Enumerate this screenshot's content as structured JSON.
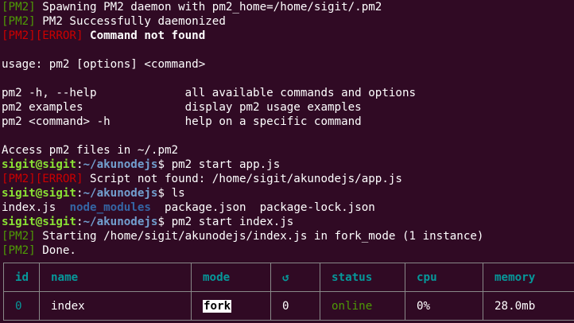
{
  "terminal": {
    "lines": [
      {
        "tag": "[PM2]",
        "text": " Spawning PM2 daemon with pm2_home=/home/sigit/.pm2"
      },
      {
        "tag": "[PM2]",
        "text": " PM2 Successfully daemonized"
      },
      {
        "tag": "[PM2][ERROR]",
        "bold_text": " Command not found"
      },
      {
        "text": ""
      },
      {
        "text": "usage: pm2 [options] <command>"
      },
      {
        "text": ""
      },
      {
        "text": "pm2 -h, --help             all available commands and options"
      },
      {
        "text": "pm2 examples               display pm2 usage examples"
      },
      {
        "text": "pm2 <command> -h           help on a specific command"
      },
      {
        "text": ""
      },
      {
        "text": "Access pm2 files in ~/.pm2"
      },
      {
        "prompt_user": "sigit@sigit",
        "prompt_path": "~/akunodejs",
        "command": " pm2 start app.js"
      },
      {
        "tag": "[PM2][ERROR]",
        "text": " Script not found: /home/sigit/akunodejs/app.js"
      },
      {
        "prompt_user": "sigit@sigit",
        "prompt_path": "~/akunodejs",
        "command": " ls"
      },
      {
        "ls": [
          "index.js",
          "node_modules",
          "package.json",
          "package-lock.json"
        ]
      },
      {
        "prompt_user": "sigit@sigit",
        "prompt_path": "~/akunodejs",
        "command": " pm2 start index.js"
      },
      {
        "tag": "[PM2]",
        "text": " Starting /home/sigit/akunodejs/index.js in fork_mode (1 instance)"
      },
      {
        "tag": "[PM2]",
        "text": " Done."
      }
    ]
  },
  "table": {
    "headers": [
      "id",
      "name",
      "mode",
      "↺",
      "status",
      "cpu",
      "memory"
    ],
    "rows": [
      {
        "id": "0",
        "name": "index",
        "mode": "fork",
        "restarts": "0",
        "status": "online",
        "cpu": "0%",
        "memory": "28.0mb"
      }
    ]
  },
  "colors": {
    "background": "#300a24",
    "pm2_tag": "#4e9a06",
    "error_tag": "#cc0000",
    "prompt_user": "#8ae234",
    "prompt_path": "#729fcf",
    "directory": "#3465a4",
    "table_header": "#06989a",
    "status_online": "#4e9a06"
  }
}
